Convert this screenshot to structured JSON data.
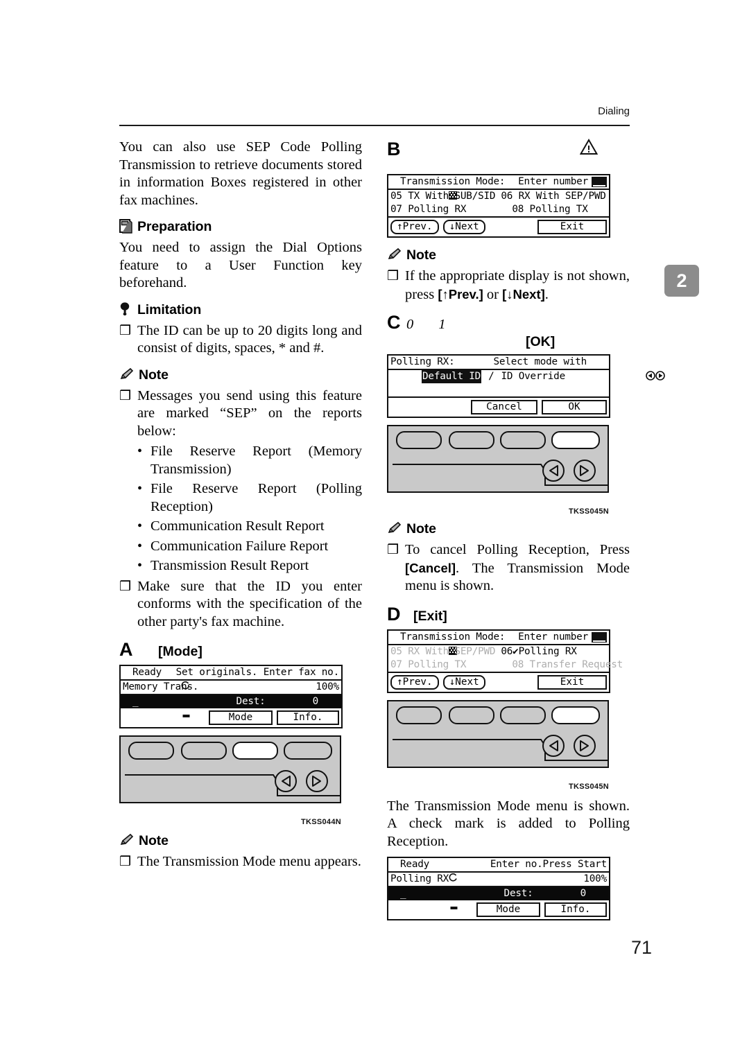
{
  "header": {
    "running_head": "Dialing",
    "chapter_tab": "2",
    "page_number": "71"
  },
  "left_column": {
    "intro": "You can also use SEP Code Polling Transmission to retrieve documents stored in information Boxes registered in other fax machines.",
    "preparation": {
      "heading": "Preparation",
      "icon": "book-icon",
      "text": "You need to assign the Dial Options feature to a User Function key beforehand."
    },
    "limitation": {
      "heading": "Limitation",
      "icon": "pin-icon",
      "items": [
        "The ID can be up to 20 digits long and consist of digits, spaces, * and #."
      ]
    },
    "note": {
      "heading": "Note",
      "icon": "pencil-icon",
      "item1": "Messages you send using this feature are marked “SEP” on the reports below:",
      "bullets": [
        "File Reserve Report (Memory Transmission)",
        "File Reserve Report (Polling Reception)",
        "Communication Result Report",
        "Communication Failure Report",
        "Transmission Result Report"
      ],
      "item2": "Make sure that the ID you enter conforms with the specification of the other party's fax machine."
    },
    "step_a": {
      "letter": "A",
      "label": "[Mode]",
      "lcd": {
        "status_icon": "ready-circle-icon",
        "status": "Ready",
        "prompt": "Set originals. Enter fax no.",
        "mode": "Memory Trans.",
        "zoom": "100%",
        "phone_icon": "telephone-icon",
        "entry_cursor": "_",
        "dest_label": "Dest:",
        "dest_value": "0",
        "button_mode": "Mode",
        "button_info": "Info."
      },
      "panel": {
        "code": "TKSS044N",
        "highlighted_key_index": 2,
        "left_arrow_icon": "triangle-left-icon",
        "right_arrow_icon": "triangle-right-icon"
      }
    },
    "note_after_a": {
      "heading": "Note",
      "icon": "pencil-icon",
      "items": [
        "The Transmission Mode menu appears."
      ]
    }
  },
  "right_column": {
    "step_b": {
      "letter": "B",
      "warning_icon": "warning-triangle-icon",
      "lcd": {
        "grid_icon": "grid-icon",
        "title": "Transmission Mode:",
        "prompt": "Enter number",
        "cursor_block": "cursor-block",
        "items": [
          "05 TX With SUB/SID",
          "06 RX With SEP/PWD",
          "07 Polling RX",
          "08 Polling TX"
        ],
        "button_prev": "↑Prev.",
        "button_next": "↓Next",
        "button_exit": "Exit"
      }
    },
    "note_after_b": {
      "heading": "Note",
      "icon": "pencil-icon",
      "item_pre": "If the appropriate display is not shown, press ",
      "key1": "[↑Prev.]",
      "item_mid": " or ",
      "key2": "[↓Next]",
      "item_post": "."
    },
    "step_c": {
      "letter": "C",
      "num0": "0",
      "num1": "1",
      "label_ok": "[OK]",
      "lcd": {
        "title": "Polling RX:",
        "prompt": "Select mode with",
        "left_arrow_icon": "circle-left-arrow-icon",
        "right_arrow_icon": "circle-right-arrow-icon",
        "option_selected": "Default ID",
        "separator": "/",
        "option_other": "ID Override",
        "button_cancel": "Cancel",
        "button_ok": "OK"
      },
      "panel": {
        "code": "TKSS045N",
        "highlighted_key_index": 3,
        "left_arrow_icon": "triangle-left-icon",
        "right_arrow_icon": "triangle-right-icon"
      }
    },
    "note_after_c": {
      "heading": "Note",
      "icon": "pencil-icon",
      "item_pre": "To cancel Polling Reception, Press ",
      "key1": "[Cancel]",
      "item_post": ". The Transmission Mode menu is shown."
    },
    "step_d": {
      "letter": "D",
      "label": "[Exit]",
      "lcd": {
        "grid_icon": "grid-icon",
        "title": "Transmission Mode:",
        "prompt": "Enter number",
        "cursor_block": "cursor-block",
        "item_05": "05 RX With SEP/PWD",
        "item_06": "06✔Polling RX",
        "item_07": "07 Polling TX",
        "item_08": "08 Transfer Request",
        "button_prev": "↑Prev.",
        "button_next": "↓Next",
        "button_exit": "Exit"
      },
      "panel": {
        "code": "TKSS045N",
        "highlighted_key_index": 3,
        "left_arrow_icon": "triangle-left-icon",
        "right_arrow_icon": "triangle-right-icon"
      }
    },
    "closing_text": "The Transmission Mode menu is shown. A check mark is added to Polling Reception.",
    "final_lcd": {
      "status_icon": "ready-circle-icon",
      "status": "Ready",
      "prompt": "Enter no.Press Start",
      "mode": "Polling RX",
      "zoom": "100%",
      "phone_icon": "telephone-icon",
      "entry_cursor": "_",
      "dest_label": "Dest:",
      "dest_value": "0",
      "button_mode": "Mode",
      "button_info": "Info."
    }
  }
}
